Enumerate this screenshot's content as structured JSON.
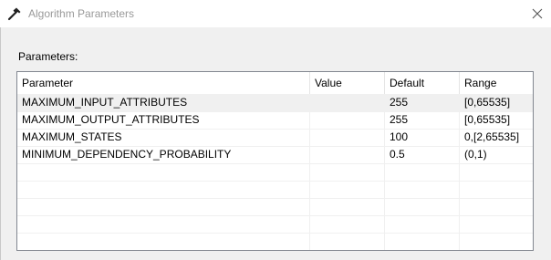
{
  "window": {
    "title": "Algorithm Parameters",
    "icon": "hammer-icon",
    "close_icon": "close-icon"
  },
  "group": {
    "label": "Parameters:"
  },
  "table": {
    "columns": [
      "Parameter",
      "Value",
      "Default",
      "Range"
    ],
    "rows": [
      {
        "parameter": "MAXIMUM_INPUT_ATTRIBUTES",
        "value": "",
        "default": "255",
        "range": "[0,65535]"
      },
      {
        "parameter": "MAXIMUM_OUTPUT_ATTRIBUTES",
        "value": "",
        "default": "255",
        "range": "[0,65535]"
      },
      {
        "parameter": "MAXIMUM_STATES",
        "value": "",
        "default": "100",
        "range": "0,[2,65535]"
      },
      {
        "parameter": "MINIMUM_DEPENDENCY_PROBABILITY",
        "value": "",
        "default": "0.5",
        "range": "(0,1)"
      }
    ],
    "selected_row": 0,
    "colors": {
      "selected_row": "#f0f0f0",
      "border": "#828790"
    }
  }
}
